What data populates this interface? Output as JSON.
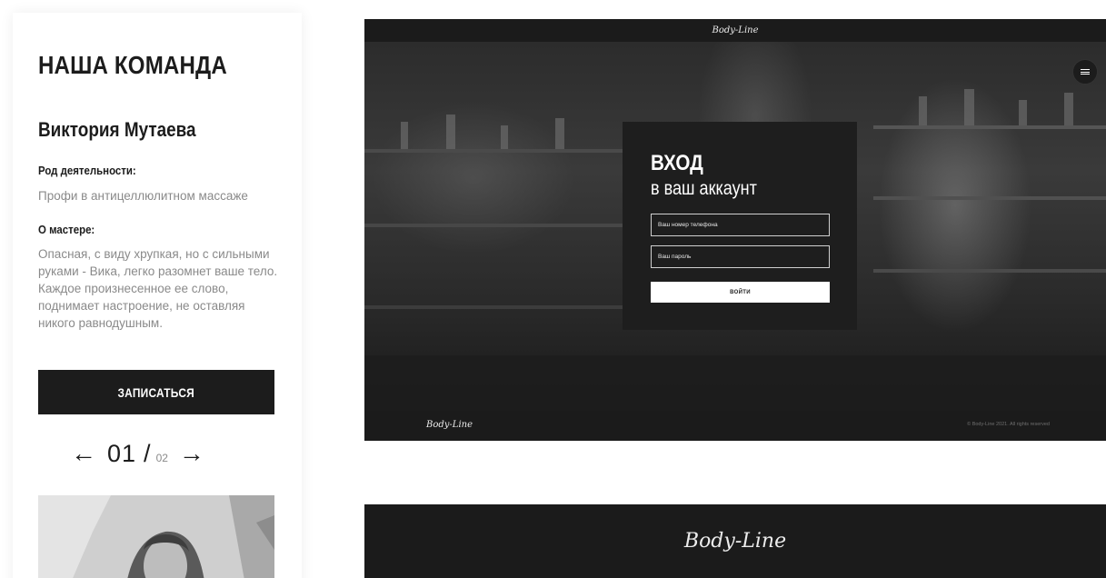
{
  "team": {
    "title": "НАША КОМАНДА",
    "master_name": "Виктория Мутаева",
    "occupation_label": "Род деятельности:",
    "occupation_value": "Профи в антицеллюлитном массаже",
    "about_label": "О мастере:",
    "about_value": "Опасная, с виду хрупкая, но с сильными руками - Вика, легко разомнет ваше тело. Каждое произнесенное ее слово, поднимает настроение, не оставляя никого равнодушным.",
    "book_button": "ЗАПИСАТЬСЯ",
    "pager": {
      "prev": "←",
      "current": "01",
      "separator": "/",
      "total": "02",
      "next": "→"
    }
  },
  "login": {
    "header_logo": "Body-Line",
    "title_line1": "ВХОД",
    "title_line2": "в ваш аккаунт",
    "phone_placeholder": "Ваш номер телефона",
    "password_placeholder": "Ваш пароль",
    "submit_label": "ВОЙТИ",
    "footer_logo": "Body-Line",
    "copyright": "© Body-Line 2021. All rights reserved",
    "menu_icon": "hamburger-menu-icon"
  },
  "banner": {
    "logo": "Body-Line"
  },
  "colors": {
    "dark": "#1c1c1c",
    "muted_text": "#8a8a8a",
    "white": "#ffffff"
  }
}
